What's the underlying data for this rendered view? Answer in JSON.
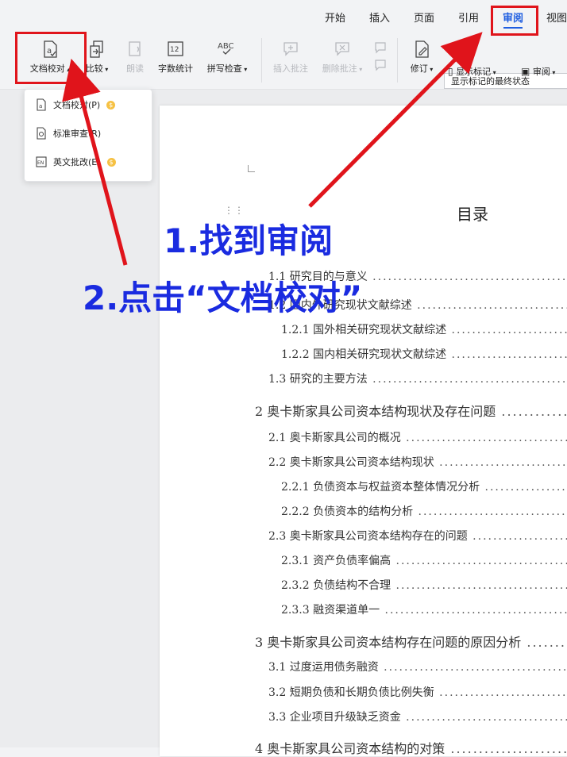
{
  "tabs": [
    "开始",
    "插入",
    "页面",
    "引用",
    "审阅",
    "视图"
  ],
  "ribbon": {
    "proofread": "文档校对",
    "compare": "比较",
    "read_aloud": "朗读",
    "word_count": "字数统计",
    "word_count_icon": "12",
    "spell_check": "拼写检查",
    "spell_check_icon": "ABC",
    "insert_comment": "插入批注",
    "delete_comment": "删除批注",
    "revise": "修订",
    "show_markup": "显示标记",
    "review": "审阅",
    "display_select": "显示标记的最终状态"
  },
  "dropdown": {
    "items": [
      {
        "label": "文档校对(P)",
        "paid": true
      },
      {
        "label": "标准审查(R)",
        "paid": false
      },
      {
        "label": "英文批改(E)",
        "paid": true
      }
    ],
    "en_icon": "EN"
  },
  "document": {
    "toc_title": "目录",
    "entries": [
      {
        "text": "1.1 研究目的与意义"
      },
      {
        "text": "1.2 国内外研究现状文献综述"
      },
      {
        "text": "1.2.1 国外相关研究现状文献综述"
      },
      {
        "text": "1.2.2 国内相关研究现状文献综述"
      },
      {
        "text": "1.3 研究的主要方法"
      },
      {
        "text": "2 奥卡斯家具公司资本结构现状及存在问题"
      },
      {
        "text": "2.1 奥卡斯家具公司的概况"
      },
      {
        "text": "2.2 奥卡斯家具公司资本结构现状"
      },
      {
        "text": "2.2.1 负债资本与权益资本整体情况分析"
      },
      {
        "text": "2.2.2 负债资本的结构分析"
      },
      {
        "text": "2.3 奥卡斯家具公司资本结构存在的问题"
      },
      {
        "text": "2.3.1 资产负债率偏高"
      },
      {
        "text": "2.3.2 负债结构不合理"
      },
      {
        "text": "2.3.3 融资渠道单一"
      },
      {
        "text": "3 奥卡斯家具公司资本结构存在问题的原因分析"
      },
      {
        "text": "3.1 过度运用债务融资"
      },
      {
        "text": "3.2 短期负债和长期负债比例失衡"
      },
      {
        "text": "3.3 企业项目升级缺乏资金"
      },
      {
        "text": "4 奥卡斯家具公司资本结构的对策"
      }
    ]
  },
  "annotations": {
    "step1": "1.找到审阅",
    "step2": "2.点击“文档校对”"
  },
  "colors": {
    "accent": "#1f5ee0",
    "annotation_red": "#e0141b",
    "annotation_blue": "#1a2be0"
  }
}
